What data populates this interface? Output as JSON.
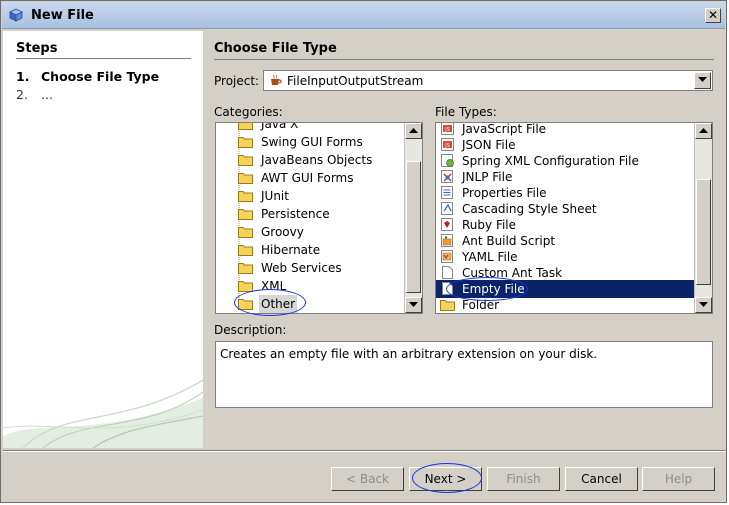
{
  "window": {
    "title": "New File"
  },
  "steps": {
    "heading": "Steps",
    "items": [
      {
        "num": "1.",
        "label": "Choose File Type"
      },
      {
        "num": "2.",
        "label": "..."
      }
    ]
  },
  "main": {
    "heading": "Choose File Type",
    "project_label": "Project:",
    "project_value": "FileInputOutputStream",
    "categories_label": "Categories:",
    "file_types_label": "File Types:",
    "description_label": "Description:",
    "description_text": "Creates an empty file with an arbitrary extension on your disk."
  },
  "categories": [
    {
      "label": "Java X",
      "icon": "folder-icon"
    },
    {
      "label": "Swing GUI Forms",
      "icon": "folder-icon"
    },
    {
      "label": "JavaBeans Objects",
      "icon": "folder-icon"
    },
    {
      "label": "AWT GUI Forms",
      "icon": "folder-icon"
    },
    {
      "label": "JUnit",
      "icon": "folder-icon"
    },
    {
      "label": "Persistence",
      "icon": "folder-icon"
    },
    {
      "label": "Groovy",
      "icon": "folder-icon"
    },
    {
      "label": "Hibernate",
      "icon": "folder-icon"
    },
    {
      "label": "Web Services",
      "icon": "folder-icon"
    },
    {
      "label": "XML",
      "icon": "folder-icon"
    },
    {
      "label": "Other",
      "icon": "folder-icon",
      "selected": true
    }
  ],
  "file_types": [
    {
      "label": "JavaScript File",
      "icon": "script-file-icon"
    },
    {
      "label": "JSON File",
      "icon": "script-file-icon"
    },
    {
      "label": "Spring XML Configuration File",
      "icon": "spring-file-icon"
    },
    {
      "label": "JNLP File",
      "icon": "jnlp-file-icon"
    },
    {
      "label": "Properties File",
      "icon": "properties-file-icon"
    },
    {
      "label": "Cascading Style Sheet",
      "icon": "css-file-icon"
    },
    {
      "label": "Ruby File",
      "icon": "ruby-file-icon"
    },
    {
      "label": "Ant Build Script",
      "icon": "ant-file-icon"
    },
    {
      "label": "YAML File",
      "icon": "yaml-file-icon"
    },
    {
      "label": "Custom Ant Task",
      "icon": "blank-file-icon"
    },
    {
      "label": "Empty File",
      "icon": "blank-file-icon",
      "selected": true
    },
    {
      "label": "Folder",
      "icon": "folder-icon"
    }
  ],
  "buttons": {
    "back": "< Back",
    "next": "Next >",
    "finish": "Finish",
    "cancel": "Cancel",
    "help": "Help"
  },
  "colors": {
    "selection": "#0a246a",
    "annotation": "#1b35e8",
    "dialog_bg": "#d4d0c8"
  }
}
